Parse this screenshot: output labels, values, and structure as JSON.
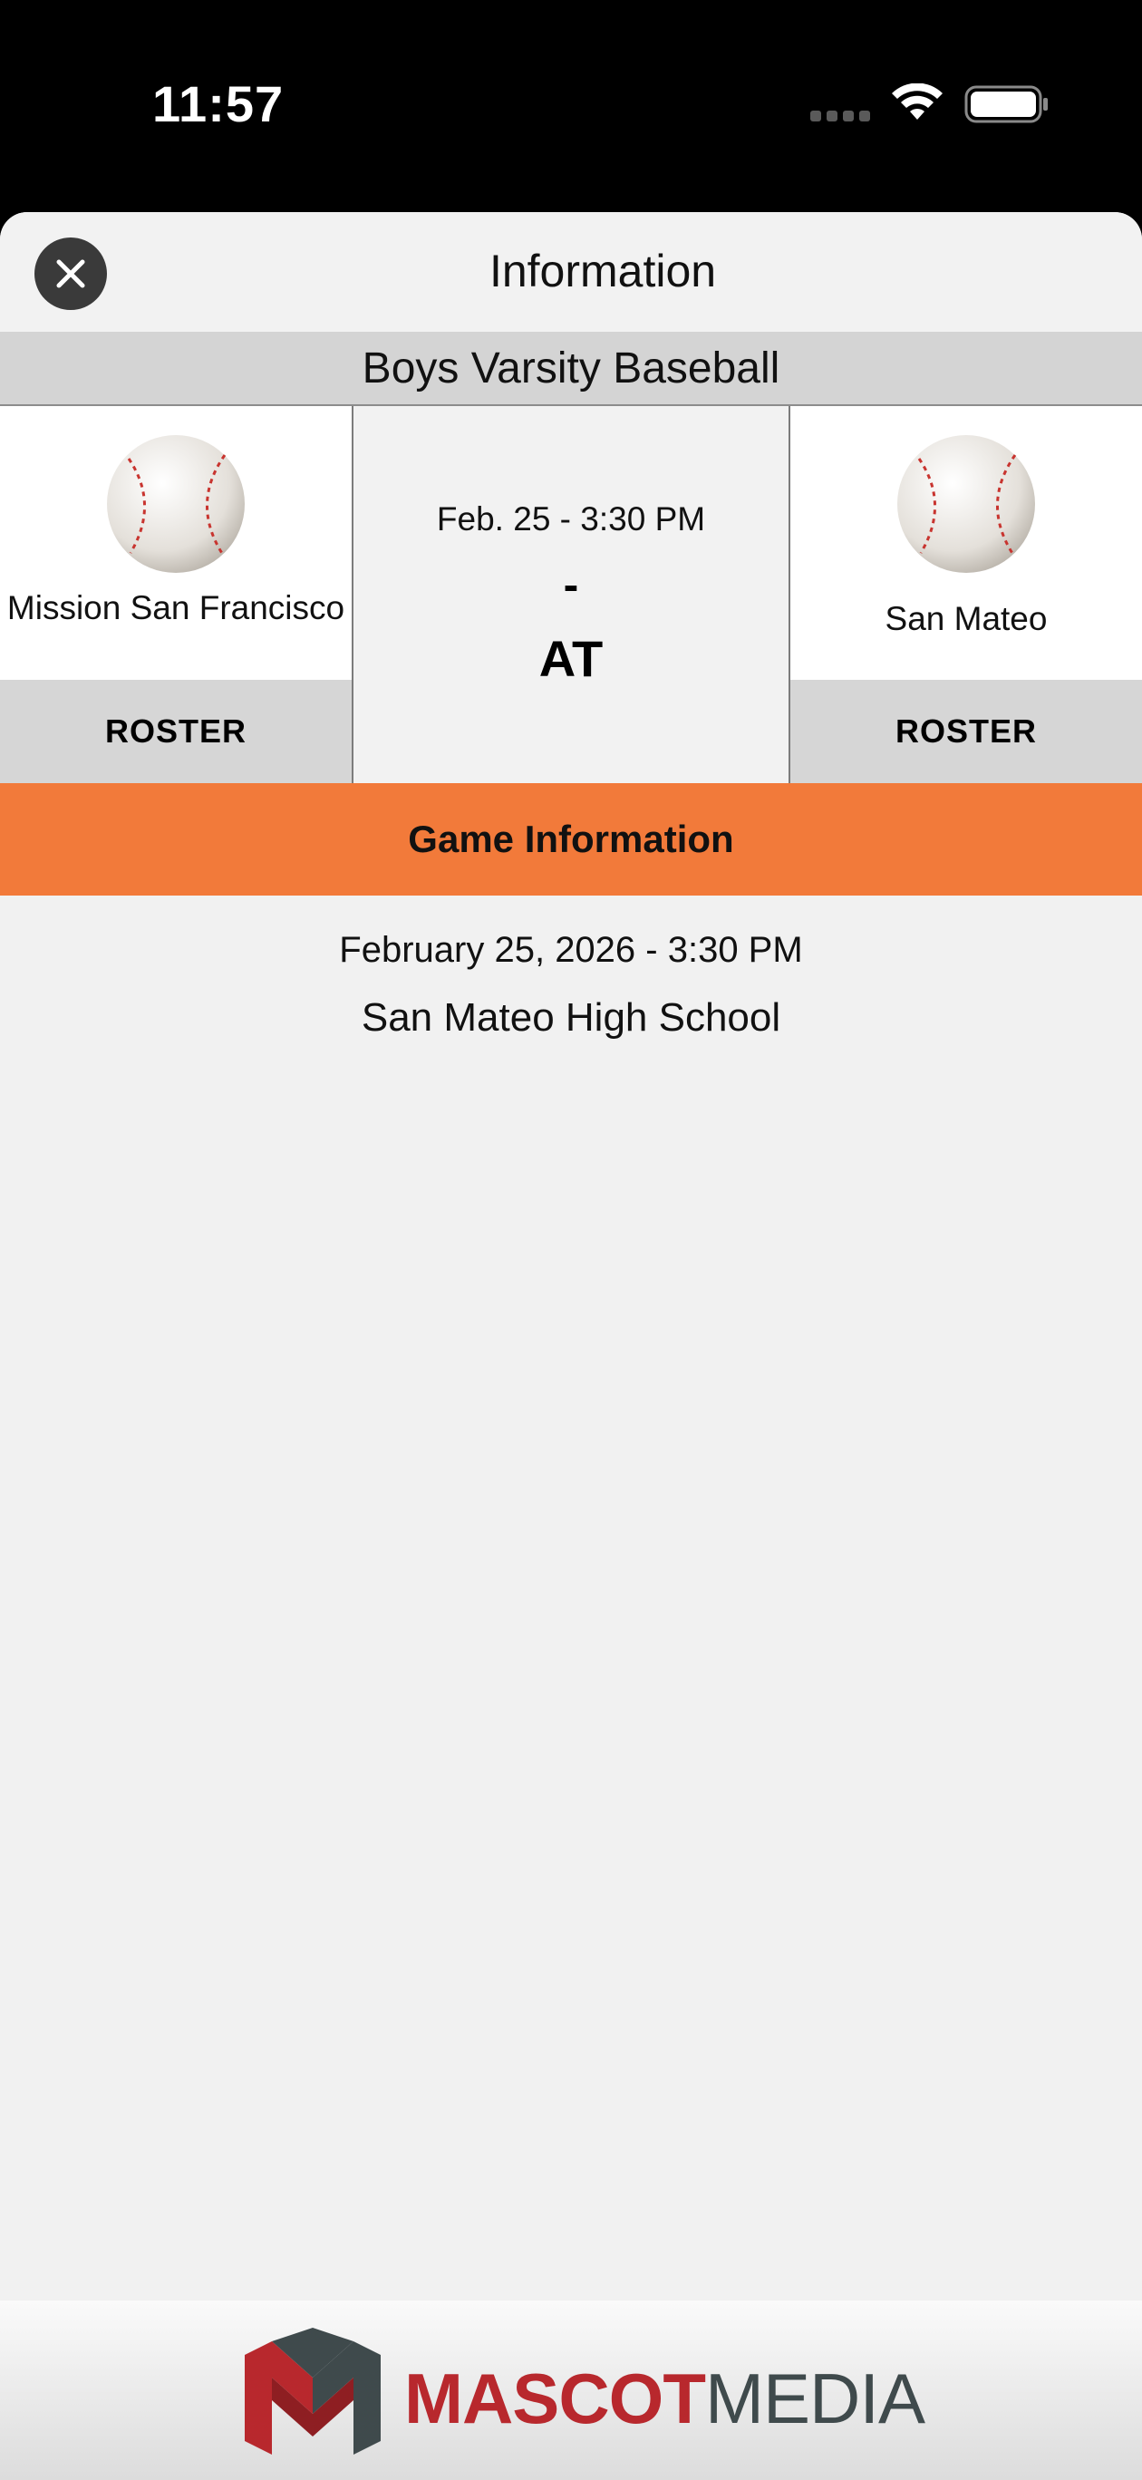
{
  "status_bar": {
    "time": "11:57"
  },
  "header": {
    "title": "Information",
    "close_icon": "close-icon"
  },
  "sport": "Boys Varsity Baseball",
  "matchup": {
    "away": {
      "name": "Mission San Francisco",
      "logo": "baseball-icon",
      "roster_label": "ROSTER"
    },
    "home": {
      "name": "San Mateo",
      "logo": "baseball-icon",
      "roster_label": "ROSTER"
    },
    "game_time": "Feb. 25 - 3:30 PM",
    "score": "-",
    "vs_label": "AT"
  },
  "game_info": {
    "header": "Game Information",
    "datetime": "February 25, 2026 - 3:30 PM",
    "location": "San Mateo High School"
  },
  "footer": {
    "brand_part1": "MASCOT",
    "brand_part2": "MEDIA"
  },
  "colors": {
    "accent": "#f27a3a",
    "brand_red": "#b8282d",
    "brand_gray": "#3f4a4c"
  }
}
